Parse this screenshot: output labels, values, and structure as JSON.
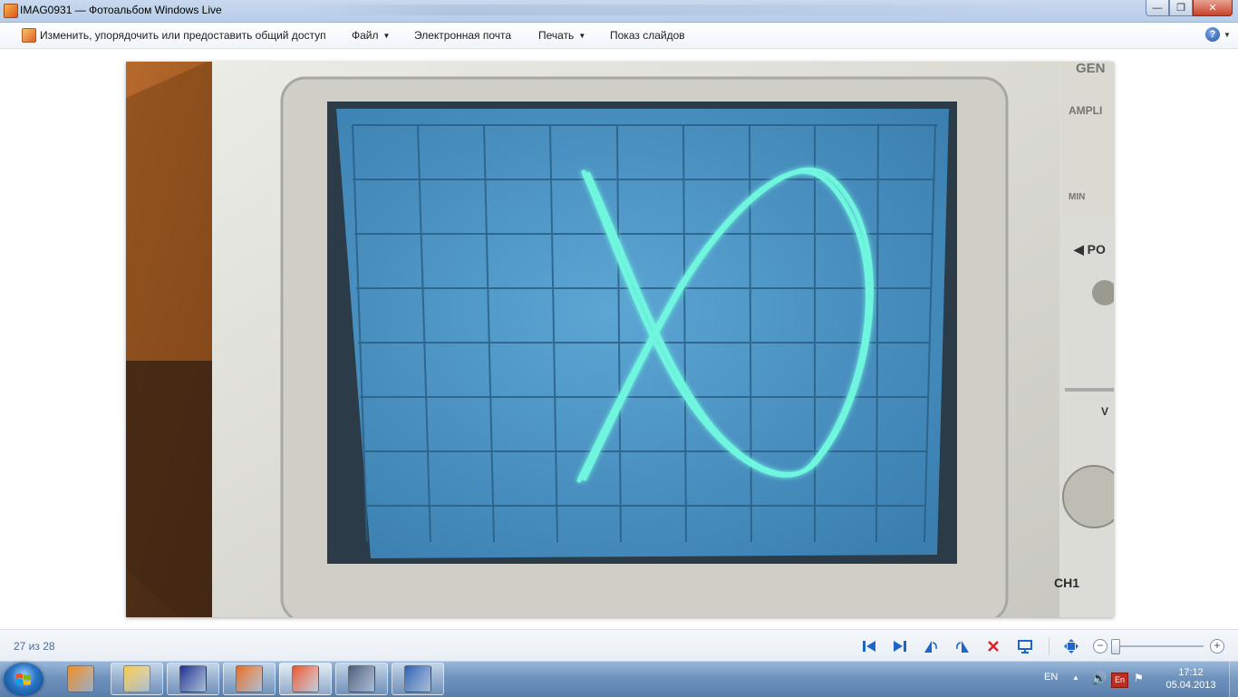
{
  "window": {
    "title": "IMAG0931 — Фотоальбом Windows Live",
    "controls": {
      "minimize": "—",
      "maximize": "❐",
      "close": "✕"
    }
  },
  "commandbar": {
    "items": [
      {
        "label": "Изменить, упорядочить или предоставить общий доступ",
        "has_menu": false
      },
      {
        "label": "Файл",
        "has_menu": true
      },
      {
        "label": "Электронная почта",
        "has_menu": false
      },
      {
        "label": "Печать",
        "has_menu": true
      },
      {
        "label": "Показ слайдов",
        "has_menu": false
      }
    ],
    "menu_arrow": "▼",
    "help": "?"
  },
  "photo": {
    "description_icon": "photo-viewer",
    "screen_color": "#4d97c6",
    "trace_color": "#5ff2d8",
    "bezel_color": "#d8d8d2",
    "side_labels": [
      "GEN",
      "AMPLI",
      "MIN",
      "◀ PO",
      "V",
      "CH1"
    ]
  },
  "navbar": {
    "counter": "27 из 28",
    "icons": [
      "previous-icon",
      "next-icon",
      "rotate-left-icon",
      "rotate-right-icon",
      "delete-icon",
      "slideshow-icon",
      "actual-size-icon"
    ],
    "zoom_minus": "−",
    "zoom_plus": "+",
    "zoom_level": 0.02
  },
  "taskbar": {
    "apps": [
      {
        "name": "media-player-icon",
        "open": false,
        "color": "#f08a1c"
      },
      {
        "name": "explorer-icon",
        "open": true,
        "color": "#f2c94c"
      },
      {
        "name": "floppy-app-icon",
        "open": true,
        "color": "#1c2f8f"
      },
      {
        "name": "firefox-icon",
        "open": true,
        "color": "#e66a1d"
      },
      {
        "name": "photo-gallery-icon",
        "open": true,
        "active": true,
        "color": "#e9532c"
      },
      {
        "name": "mathcad-icon",
        "open": true,
        "color": "#4a5a78"
      },
      {
        "name": "word-icon",
        "open": true,
        "color": "#2b5fb4"
      }
    ],
    "tray": {
      "language": "EN",
      "show_hidden": "▲",
      "volume": "🔊",
      "keyboard_layout": "En",
      "flag": "⚑",
      "time": "17:12",
      "date": "05.04.2013"
    }
  }
}
